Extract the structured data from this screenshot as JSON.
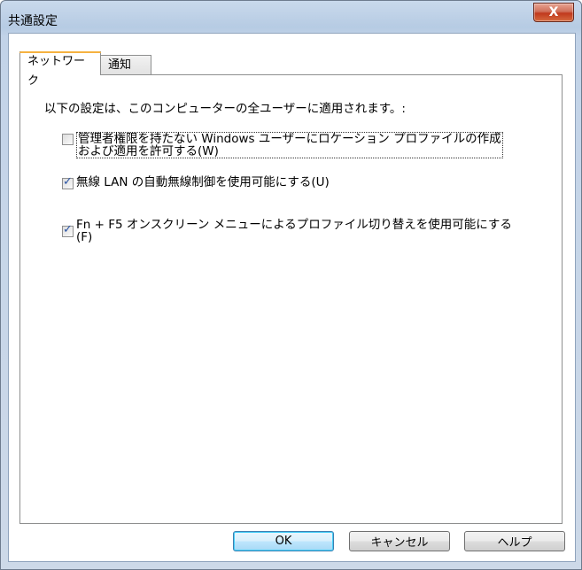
{
  "window": {
    "title": "共通設定",
    "close_glyph": "X"
  },
  "tabs": [
    {
      "label": "ネットワーク",
      "active": true
    },
    {
      "label": "通知",
      "active": false
    }
  ],
  "panel": {
    "description": "以下の設定は、このコンピューターの全ユーザーに適用されます。:",
    "options": [
      {
        "line1": "管理者権限を持たない Windows ユーザーにロケーション プロファイルの作成",
        "line2": "および適用を許可する(W)",
        "checked": false
      },
      {
        "line1": "無線 LAN の自動無線制御を使用可能にする(U)",
        "checked": true
      },
      {
        "line1": "Fn + F5 オンスクリーン メニューによるプロファイル切り替えを使用可能にする",
        "line2": "(F)",
        "checked": true
      }
    ]
  },
  "buttons": {
    "ok": "OK",
    "cancel": "キャンセル",
    "help": "ヘルプ"
  }
}
